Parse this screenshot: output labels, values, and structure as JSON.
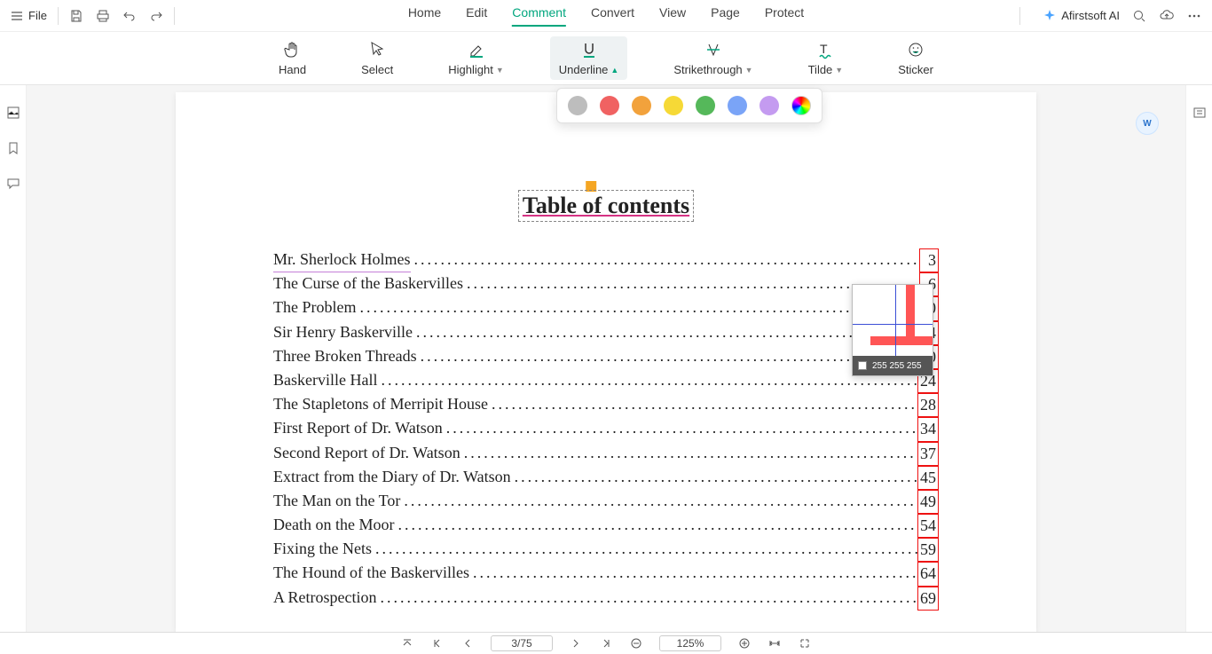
{
  "topbar": {
    "file_label": "File",
    "ai_label": "Afirstsoft AI"
  },
  "tabs": {
    "items": [
      "Home",
      "Edit",
      "Comment",
      "Convert",
      "View",
      "Page",
      "Protect"
    ],
    "active_index": 2
  },
  "tools": {
    "hand": "Hand",
    "select": "Select",
    "highlight": "Highlight",
    "underline": "Underline",
    "strikethrough": "Strikethrough",
    "tilde": "Tilde",
    "sticker": "Sticker",
    "active": "underline"
  },
  "color_palette": [
    "#bdbdbd",
    "#f06262",
    "#f2a23c",
    "#f6d936",
    "#55b85a",
    "#7aa4f7",
    "#c49bf0"
  ],
  "document": {
    "toc_title": "Table of contents",
    "entries": [
      {
        "title": "Mr. Sherlock Holmes",
        "page": "3",
        "purple": true
      },
      {
        "title": "The Curse of the Baskervilles",
        "page": "6"
      },
      {
        "title": "The Problem",
        "page": "10"
      },
      {
        "title": "Sir Henry Baskerville",
        "page": "14"
      },
      {
        "title": "Three Broken Threads",
        "page": "20"
      },
      {
        "title": "Baskerville Hall",
        "page": "24"
      },
      {
        "title": "The Stapletons of Merripit House",
        "page": "28"
      },
      {
        "title": "First Report of Dr. Watson",
        "page": "34"
      },
      {
        "title": "Second Report of Dr. Watson",
        "page": "37"
      },
      {
        "title": "Extract from the Diary of Dr. Watson",
        "page": "45"
      },
      {
        "title": "The Man on the Tor",
        "page": "49"
      },
      {
        "title": "Death on the Moor",
        "page": "54"
      },
      {
        "title": "Fixing the Nets",
        "page": "59"
      },
      {
        "title": "The Hound of the Baskervilles",
        "page": "64"
      },
      {
        "title": "A Retrospection",
        "page": "69"
      }
    ]
  },
  "magnifier": {
    "rgb": "255 255 255"
  },
  "bottombar": {
    "page_display": "3/75",
    "zoom_display": "125%"
  }
}
